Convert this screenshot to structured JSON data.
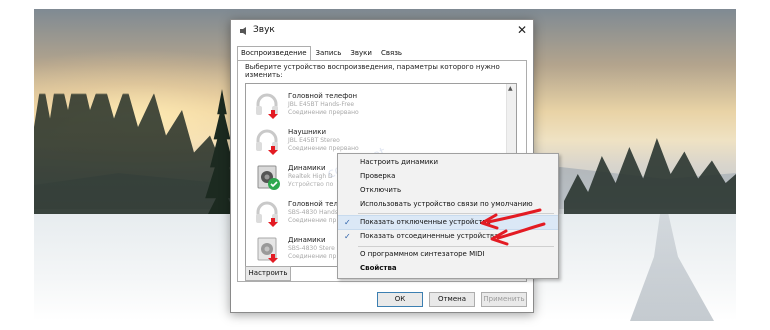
{
  "window": {
    "title": "Звук",
    "close_glyph": "✕"
  },
  "tabs": [
    {
      "label": "Воспроизведение",
      "active": true
    },
    {
      "label": "Запись",
      "active": false
    },
    {
      "label": "Звуки",
      "active": false
    },
    {
      "label": "Связь",
      "active": false
    }
  ],
  "instruction": "Выберите устройство воспроизведения, параметры которого нужно изменить:",
  "devices": [
    {
      "name": "Головной телефон",
      "description": "JBL E45BT Hands-Free",
      "status": "Соединение прервано",
      "icon": "headset-icon",
      "badge": "disconnected-arrow-icon"
    },
    {
      "name": "Наушники",
      "description": "JBL E45BT Stereo",
      "status": "Соединение прервано",
      "icon": "headphones-icon",
      "badge": "disconnected-arrow-icon"
    },
    {
      "name": "Динамики",
      "description": "Realtek High D",
      "status": "Устройство по",
      "icon": "speaker-icon",
      "badge": "default-check-icon"
    },
    {
      "name": "Головной теле",
      "description": "SBS-4830 Hands",
      "status": "Соединение пр",
      "icon": "headset-icon",
      "badge": "disconnected-arrow-icon"
    },
    {
      "name": "Динамики",
      "description": "SBS-4830 Stere",
      "status": "Соединение пр",
      "icon": "speaker-icon",
      "badge": "disconnected-arrow-icon"
    }
  ],
  "buttons": {
    "configure": "Настроить",
    "ok": "ОК",
    "cancel": "Отмена",
    "apply": "Применить"
  },
  "watermark": "comp.net",
  "context_menu": {
    "items": [
      {
        "label": "Настроить динамики",
        "checked": false,
        "highlighted": false,
        "bold": false
      },
      {
        "label": "Проверка",
        "checked": false,
        "highlighted": false,
        "bold": false
      },
      {
        "label": "Отключить",
        "checked": false,
        "highlighted": false,
        "bold": false
      },
      {
        "label": "Использовать устройство связи по умолчанию",
        "checked": false,
        "highlighted": false,
        "bold": false
      },
      {
        "label": "Показать отключенные устройства",
        "checked": true,
        "highlighted": true,
        "bold": false
      },
      {
        "label": "Показать отсоединенные устройства",
        "checked": true,
        "highlighted": false,
        "bold": false
      },
      {
        "label": "О программном синтезаторе MIDI",
        "checked": false,
        "highlighted": false,
        "bold": false
      },
      {
        "label": "Свойства",
        "checked": false,
        "highlighted": false,
        "bold": true
      }
    ],
    "check_glyph": "✓"
  },
  "colors": {
    "accent": "#e31b23",
    "highlight": "#dbe8f6",
    "default_badge": "#2fa84f"
  }
}
